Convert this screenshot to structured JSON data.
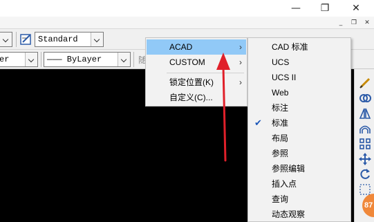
{
  "window": {
    "minimize_glyph": "—",
    "restore_glyph": "❐",
    "close_glyph": "✕"
  },
  "doc_controls": {
    "minimize_glyph": "_",
    "restore_glyph": "❐",
    "close_glyph": "✕"
  },
  "toolbar": {
    "text_style": "Standard",
    "layer_partial": "er",
    "linetype": "——— ByLayer",
    "partial_text": "随"
  },
  "context_menu": {
    "items": [
      {
        "label": "ACAD",
        "has_submenu": true,
        "highlighted": true
      },
      {
        "label": "CUSTOM",
        "has_submenu": true
      },
      {
        "label": "锁定位置(K)",
        "has_submenu": true
      },
      {
        "label": "自定义(C)..."
      }
    ],
    "submenu_glyph": "›"
  },
  "submenu": {
    "items": [
      {
        "label": "CAD 标准",
        "checked": false
      },
      {
        "label": "UCS",
        "checked": false
      },
      {
        "label": "UCS II",
        "checked": false
      },
      {
        "label": "Web",
        "checked": false
      },
      {
        "label": "标注",
        "checked": false
      },
      {
        "label": "标准",
        "checked": true
      },
      {
        "label": "布局",
        "checked": false
      },
      {
        "label": "参照",
        "checked": false
      },
      {
        "label": "参照编辑",
        "checked": false
      },
      {
        "label": "插入点",
        "checked": false
      },
      {
        "label": "查询",
        "checked": false
      },
      {
        "label": "动态观察",
        "checked": false
      }
    ],
    "check_glyph": "✔"
  },
  "badge": {
    "text": "87"
  },
  "colors": {
    "highlight": "#91c9f7",
    "arrow": "#e0202a",
    "canvas": "#000000",
    "badge": "#f0883a"
  }
}
